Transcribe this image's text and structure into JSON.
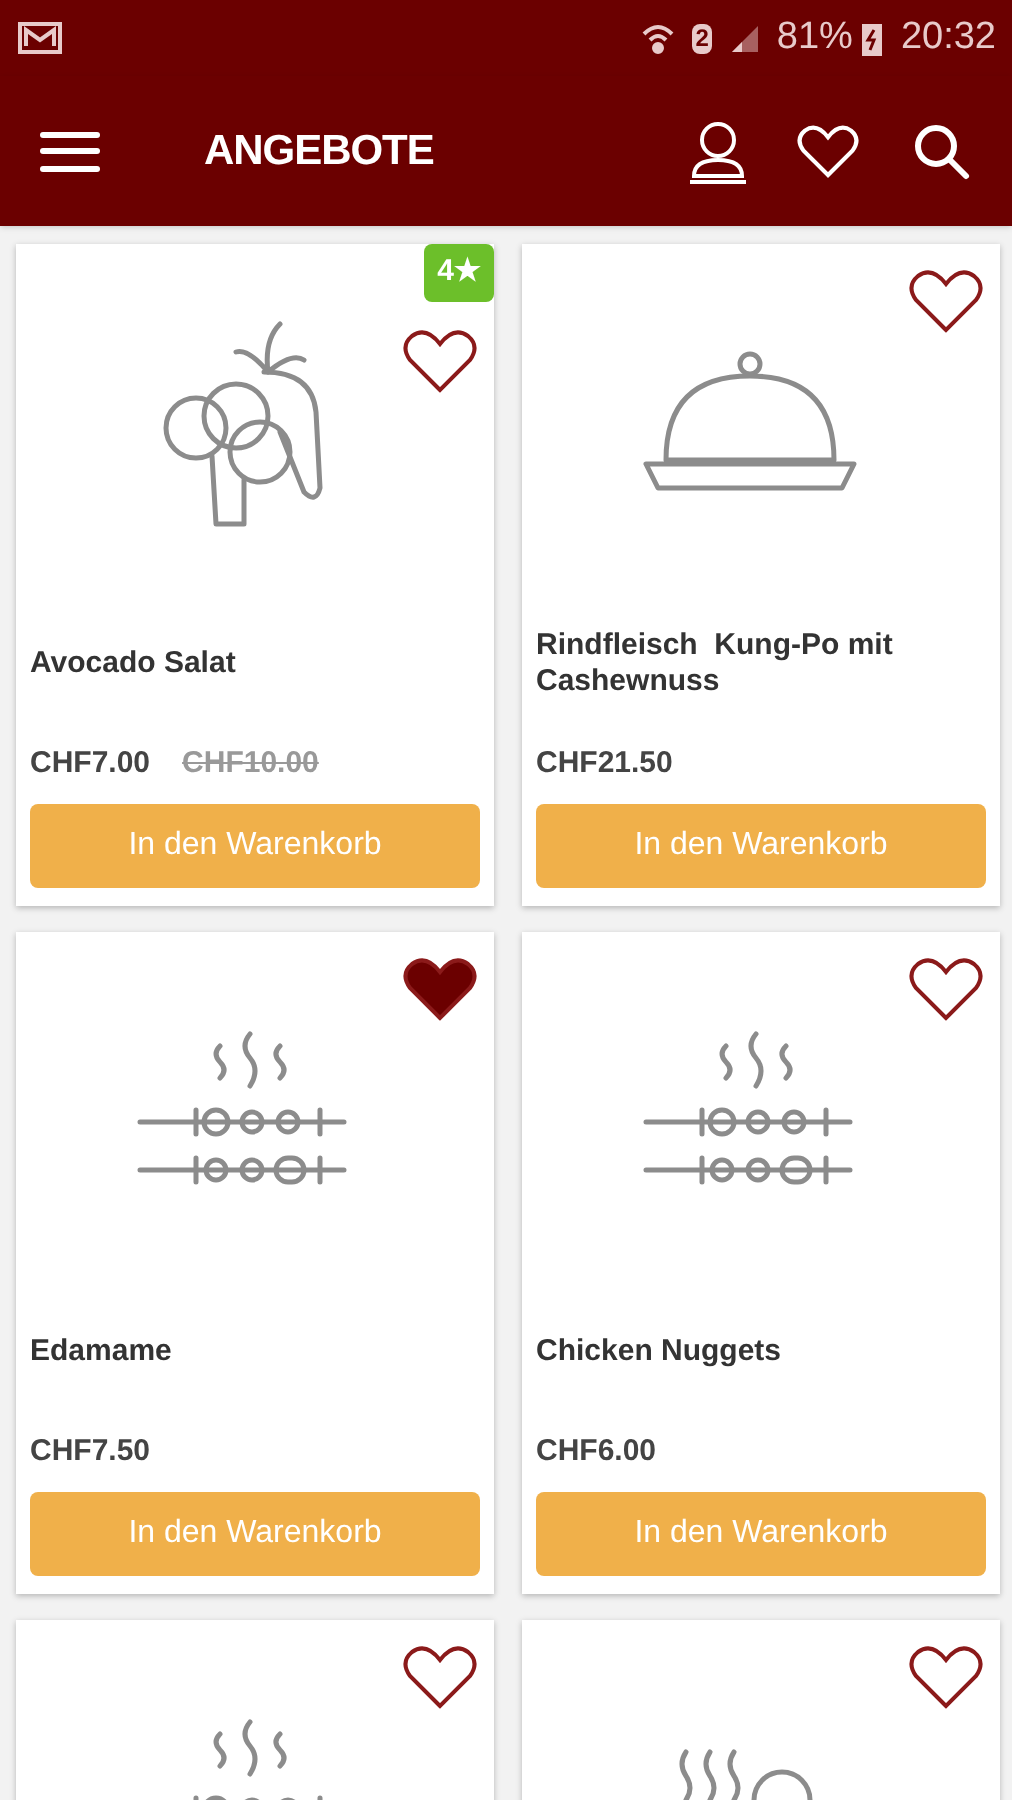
{
  "status_bar": {
    "sim": "2",
    "battery": "81%",
    "time": "20:32"
  },
  "header": {
    "title": "ANGEBOTE"
  },
  "products": [
    {
      "kind": "veggies",
      "badge": "4★",
      "favorite": false,
      "name": "Avocado Salat",
      "price": "CHF7.00",
      "old_price": "CHF10.00",
      "button": "In den Warenkorb"
    },
    {
      "kind": "cloche",
      "favorite": false,
      "name": "Rindfleisch  Kung-Po mit Cashewnuss",
      "price": "CHF21.50",
      "button": "In den Warenkorb"
    },
    {
      "kind": "skewers",
      "favorite": true,
      "name": "Edamame",
      "price": "CHF7.50",
      "button": "In den Warenkorb"
    },
    {
      "kind": "skewers",
      "favorite": false,
      "name": "Chicken Nuggets",
      "price": "CHF6.00",
      "button": "In den Warenkorb"
    },
    {
      "kind": "skewers",
      "favorite": false
    },
    {
      "kind": "soup",
      "favorite": false
    }
  ]
}
